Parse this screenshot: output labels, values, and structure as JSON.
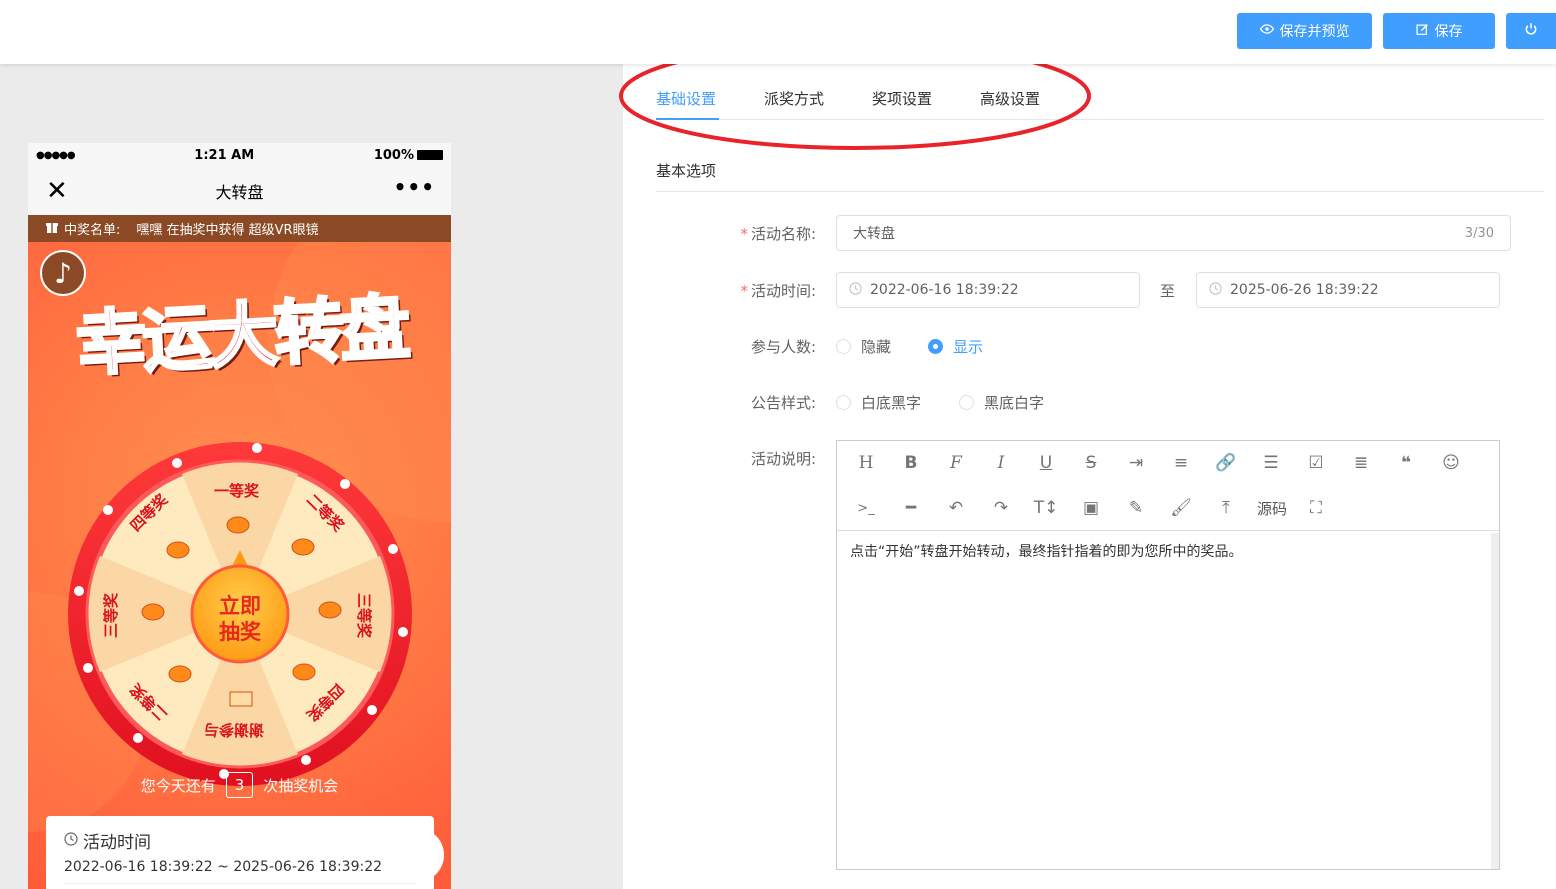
{
  "toolbar": {
    "preview_label": "保存并预览",
    "save_label": "保存",
    "power_icon": "power-icon",
    "accent": "#409eff"
  },
  "phone": {
    "status": {
      "signal": "●●●●●",
      "time": "1:21 AM",
      "battery": "100%"
    },
    "title": "大转盘",
    "winners": {
      "label": "中奖名单:",
      "text": "嘿嘿 在抽奖中获得 超级VR眼镜"
    },
    "banner": "幸运大转盘",
    "wheel": {
      "prizes": [
        "一等奖",
        "二等奖",
        "三等奖",
        "四等奖",
        "谢谢参与",
        "二等奖",
        "三等奖",
        "四等奖"
      ],
      "center_line1": "立即",
      "center_line2": "抽奖"
    },
    "chances": {
      "prefix": "您今天还有",
      "count": "3",
      "suffix": "次抽奖机会"
    },
    "card": {
      "title": "活动时间",
      "range": "2022-06-16 18:39:22 ~ 2025-06-26 18:39:22"
    }
  },
  "tabs": [
    "基础设置",
    "派奖方式",
    "奖项设置",
    "高级设置"
  ],
  "section_title": "基本选项",
  "form": {
    "name": {
      "label": "活动名称:",
      "value": "大转盘",
      "counter": "3/30"
    },
    "time": {
      "label": "活动时间:",
      "start": "2022-06-16 18:39:22",
      "sep": "至",
      "end": "2025-06-26 18:39:22"
    },
    "participants": {
      "label": "参与人数:",
      "options": [
        "隐藏",
        "显示"
      ],
      "selected": "显示"
    },
    "notice": {
      "label": "公告样式:",
      "options": [
        "白底黑字",
        "黑底白字"
      ]
    },
    "desc": {
      "label": "活动说明:",
      "source_label": "源码",
      "content": "点击“开始”转盘开始转动，最终指针指着的即为您所中的奖品。"
    }
  }
}
